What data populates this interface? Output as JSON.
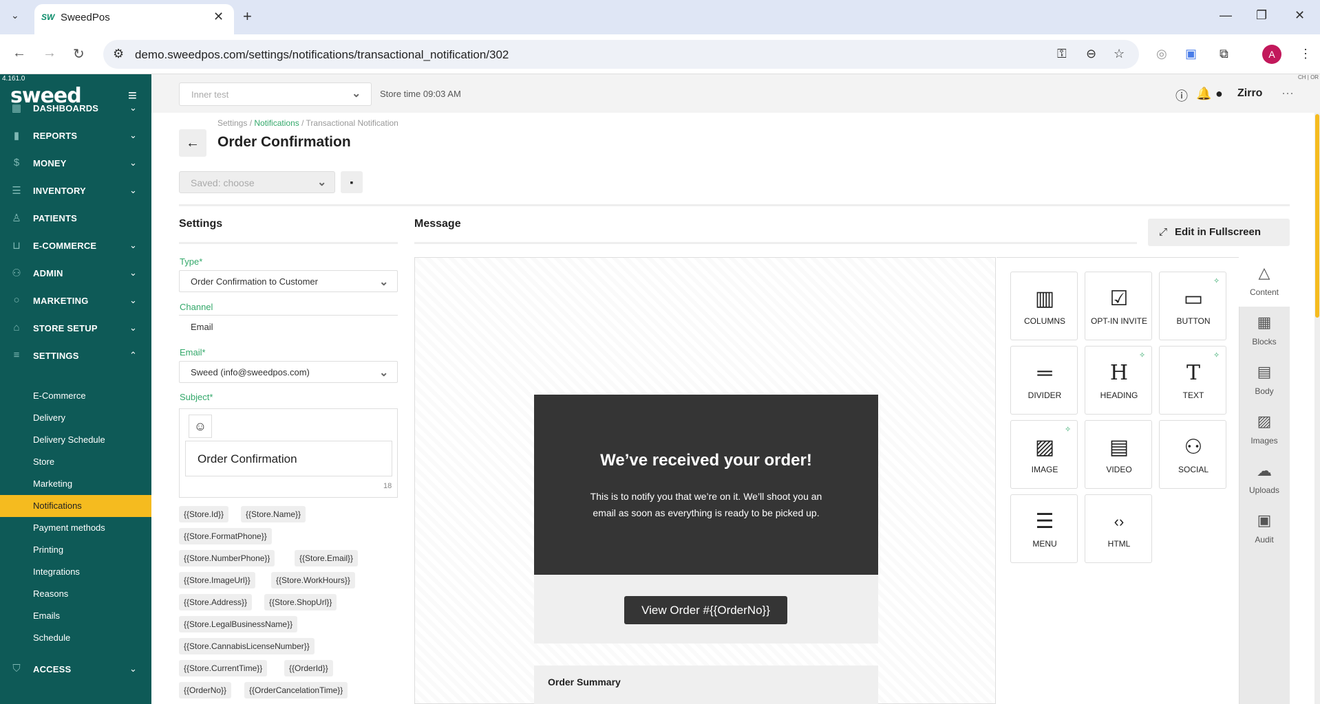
{
  "browser": {
    "tab_title": "SweedPos",
    "tab_favicon": "SW",
    "url": "demo.sweedpos.com/settings/notifications/transactional_notification/302",
    "profile_initial": "A"
  },
  "sidebar": {
    "version": "4.161.0",
    "logo": "sweed",
    "items": [
      {
        "label": "DASHBOARDS",
        "icon": "grid-icon"
      },
      {
        "label": "REPORTS",
        "icon": "bar-chart-icon"
      },
      {
        "label": "MONEY",
        "icon": "dollar-icon"
      },
      {
        "label": "INVENTORY",
        "icon": "list-icon"
      },
      {
        "label": "PATIENTS",
        "icon": "person-icon"
      },
      {
        "label": "E-COMMERCE",
        "icon": "basket-icon"
      },
      {
        "label": "ADMIN",
        "icon": "users-icon"
      },
      {
        "label": "MARKETING",
        "icon": "search-icon"
      },
      {
        "label": "STORE SETUP",
        "icon": "home-icon"
      },
      {
        "label": "SETTINGS",
        "icon": "sliders-icon"
      }
    ],
    "settings_sub": [
      "E-Commerce",
      "Delivery",
      "Delivery Schedule",
      "Store",
      "Marketing",
      "Notifications",
      "Payment methods",
      "Printing",
      "Integrations",
      "Reasons",
      "Emails",
      "Schedule"
    ],
    "active_sub": "Notifications",
    "access": {
      "label": "ACCESS",
      "icon": "shield-icon"
    }
  },
  "topbar": {
    "store_placeholder": "Inner test",
    "store_time": "Store time 09:03 AM",
    "user": "Zirro",
    "corner_text": "CH | OR"
  },
  "page": {
    "breadcrumb": [
      "Settings",
      "Notifications",
      "Transactional Notification"
    ],
    "title": "Order Confirmation",
    "saved_placeholder": "Saved: choose"
  },
  "settings": {
    "heading": "Settings",
    "type_label": "Type",
    "type_value": "Order Confirmation to Customer",
    "channel_label": "Channel",
    "channel_value": "Email",
    "email_label": "Email",
    "email_value": "Sweed (info@sweedpos.com)",
    "subject_label": "Subject",
    "subject_value": "Order Confirmation",
    "subject_count": "18",
    "placeholders": [
      "{{Store.Id}}",
      "{{Store.Name}}",
      "{{Store.FormatPhone}}",
      "{{Store.NumberPhone}}",
      "{{Store.Email}}",
      "{{Store.ImageUrl}}",
      "{{Store.WorkHours}}",
      "{{Store.Address}}",
      "{{Store.ShopUrl}}",
      "{{Store.LegalBusinessName}}",
      "{{Store.CannabisLicenseNumber}}",
      "{{Store.CurrentTime}}",
      "{{OrderId}}",
      "{{OrderNo}}",
      "{{OrderCancelationTime}}"
    ]
  },
  "message": {
    "heading": "Message",
    "fullscreen_label": "Edit in Fullscreen",
    "hero_title": "We’ve received your order!",
    "hero_text": "This is to notify you that we’re on it. We’ll shoot you an email as soon as everything is ready to be picked up.",
    "cta_label": "View Order #{{OrderNo}}",
    "summary_title": "Order Summary"
  },
  "tools": [
    {
      "label": "COLUMNS",
      "icon": "columns-icon"
    },
    {
      "label": "OPT-IN INVITE",
      "icon": "checklist-icon"
    },
    {
      "label": "BUTTON",
      "icon": "button-icon"
    },
    {
      "label": "DIVIDER",
      "icon": "divider-icon"
    },
    {
      "label": "HEADING",
      "icon": "heading-icon"
    },
    {
      "label": "TEXT",
      "icon": "text-icon"
    },
    {
      "label": "IMAGE",
      "icon": "image-icon"
    },
    {
      "label": "VIDEO",
      "icon": "video-icon"
    },
    {
      "label": "SOCIAL",
      "icon": "social-icon"
    },
    {
      "label": "MENU",
      "icon": "menu-icon"
    },
    {
      "label": "HTML",
      "icon": "code-icon"
    }
  ],
  "side_tabs": [
    "Content",
    "Blocks",
    "Body",
    "Images",
    "Uploads",
    "Audit"
  ],
  "colors": {
    "sidebar": "#0e5a57",
    "accent": "#f5bb1f",
    "link_green": "#33a86a",
    "hero_bg": "#353535"
  }
}
